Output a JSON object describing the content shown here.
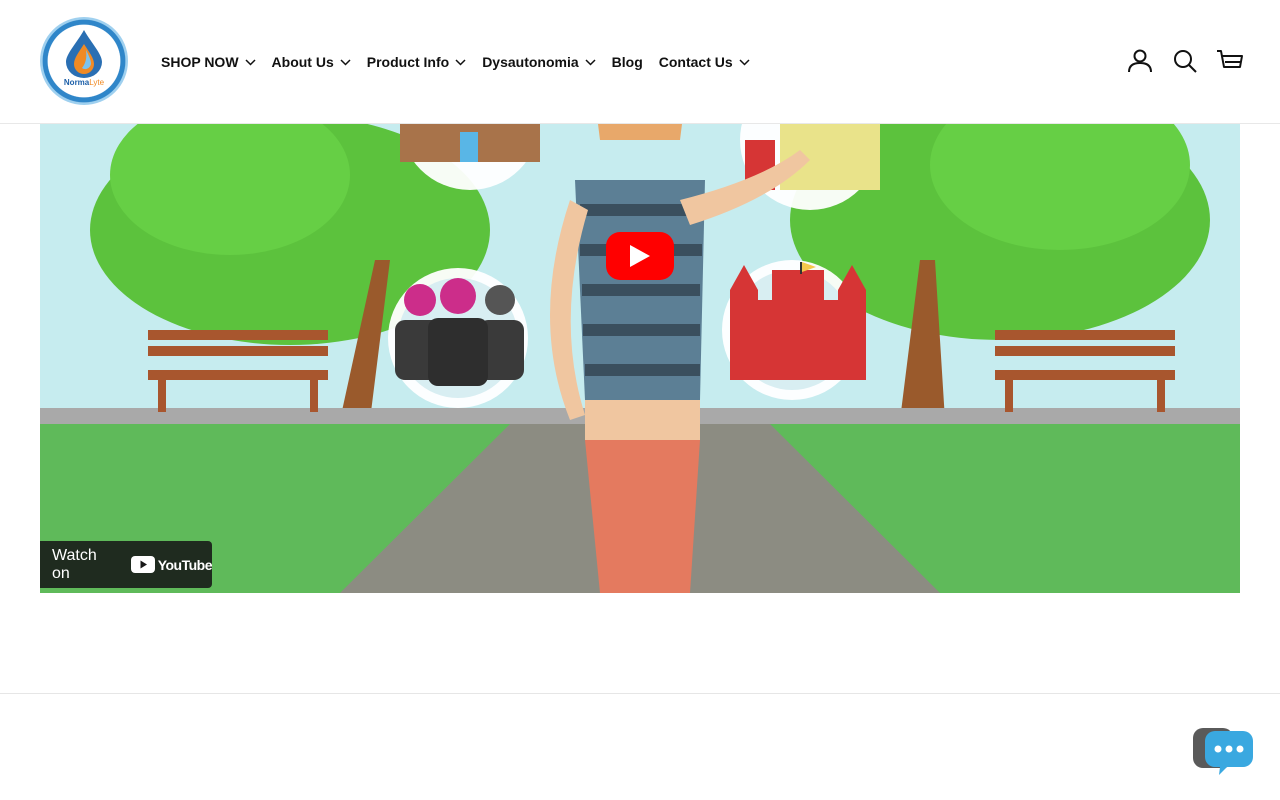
{
  "header": {
    "logo_text_main": "Norma",
    "logo_text_accent": "Lyte",
    "nav": [
      {
        "label": "SHOP NOW",
        "has_dropdown": true
      },
      {
        "label": "About Us",
        "has_dropdown": true
      },
      {
        "label": "Product Info",
        "has_dropdown": true
      },
      {
        "label": "Dysautonomia",
        "has_dropdown": true
      },
      {
        "label": "Blog",
        "has_dropdown": false
      },
      {
        "label": "Contact Us",
        "has_dropdown": true
      }
    ],
    "icons": {
      "login": {
        "icon": "user-icon",
        "label": "Log in"
      },
      "search": {
        "icon": "search-icon",
        "label": "Search"
      },
      "cart": {
        "icon": "cart-icon",
        "label": "Cart"
      }
    }
  },
  "video": {
    "watch_label": "Watch on",
    "platform": "YouTube",
    "play_icon": "play-icon"
  },
  "chat": {
    "icon": "chat-bubble-icon",
    "color": "#3aa8e0"
  },
  "colors": {
    "play": "#ff0000",
    "accent_blue": "#2a6fb3",
    "accent_orange": "#f08a24"
  }
}
